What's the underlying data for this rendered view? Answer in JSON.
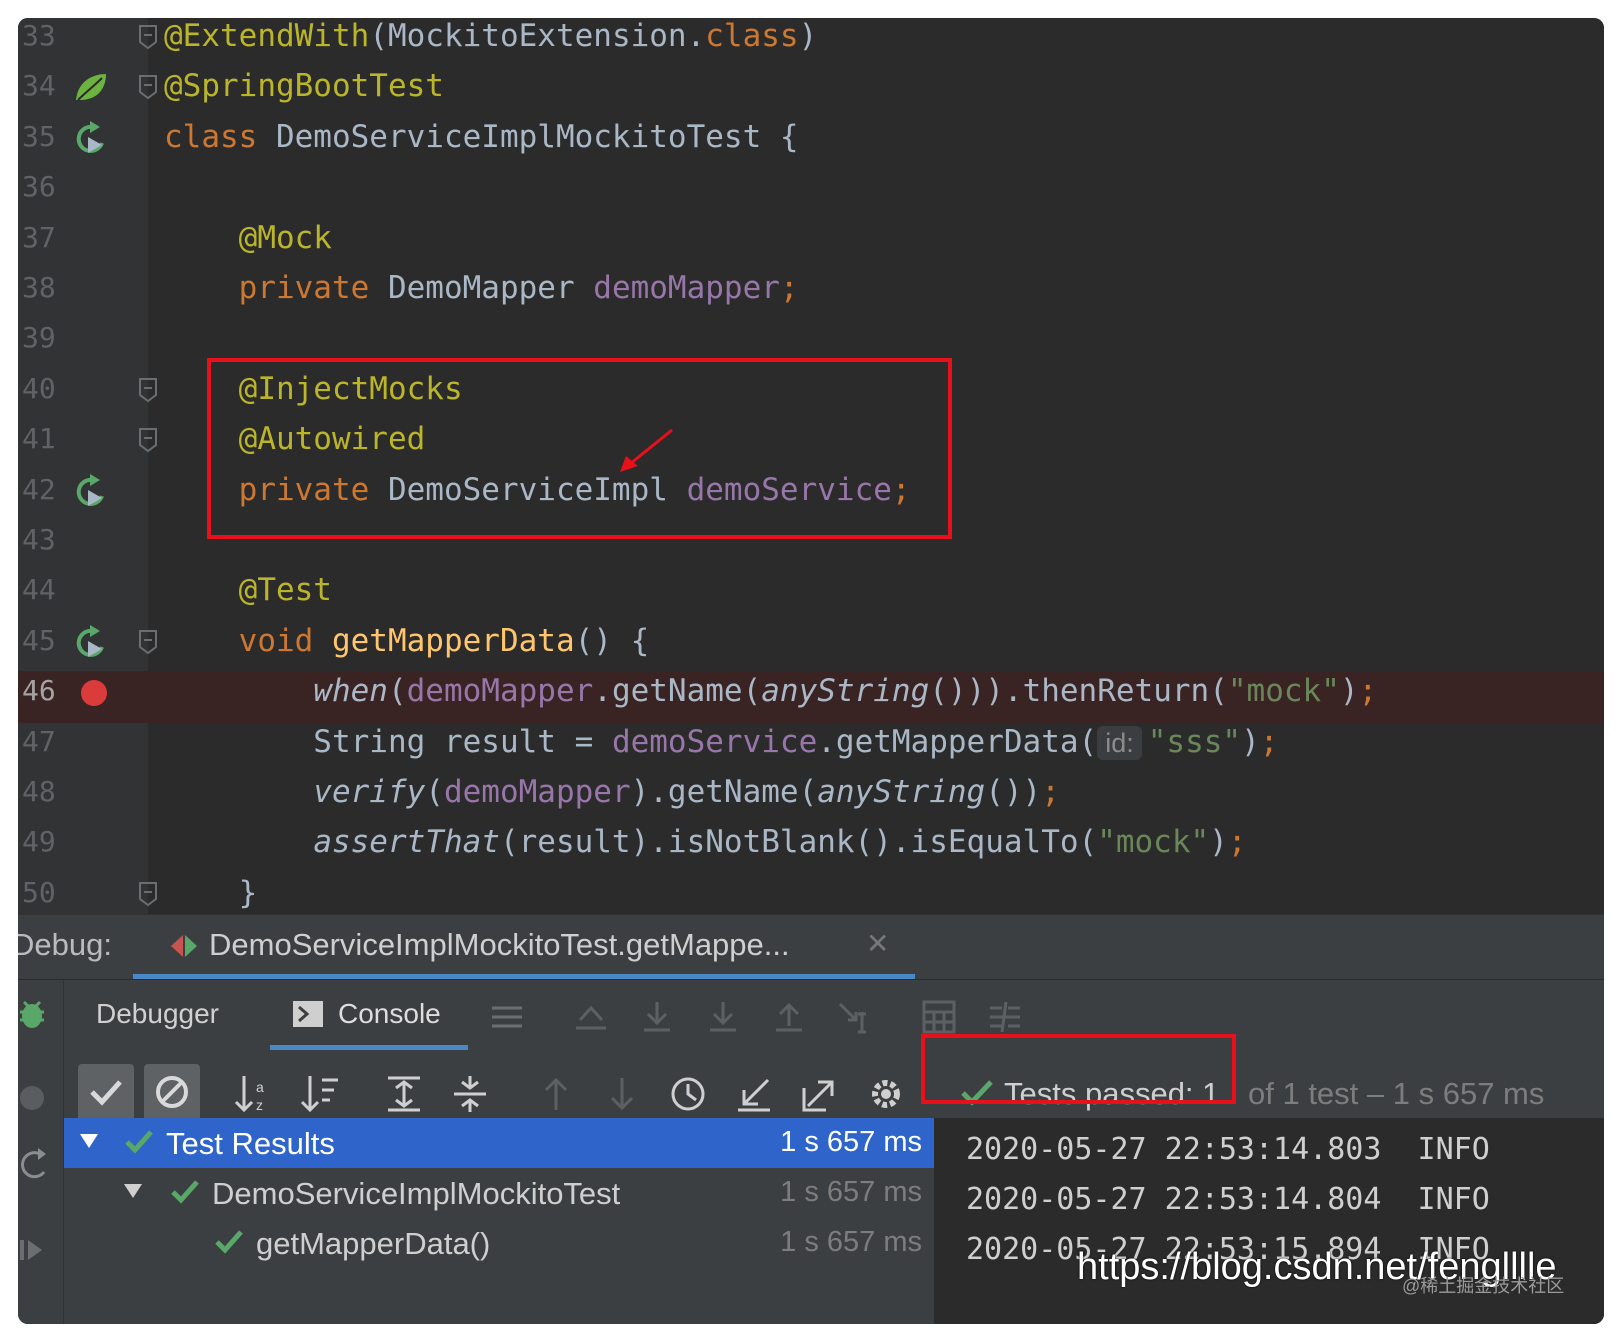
{
  "editor": {
    "lines": [
      {
        "num": "33",
        "tokens": [
          {
            "t": "@ExtendWith",
            "c": "ann"
          },
          {
            "t": "(MockitoExtension.",
            "c": ""
          },
          {
            "t": "class",
            "c": "kw"
          },
          {
            "t": ")",
            "c": ""
          }
        ]
      },
      {
        "num": "34",
        "tokens": [
          {
            "t": "@SpringBootTest",
            "c": "ann"
          }
        ]
      },
      {
        "num": "35",
        "tokens": [
          {
            "t": "class ",
            "c": "kw"
          },
          {
            "t": "DemoServiceImplMockitoTest {",
            "c": ""
          }
        ]
      },
      {
        "num": "36",
        "tokens": []
      },
      {
        "num": "37",
        "tokens": [
          {
            "t": "    ",
            "c": ""
          },
          {
            "t": "@Mock",
            "c": "ann"
          }
        ]
      },
      {
        "num": "38",
        "tokens": [
          {
            "t": "    ",
            "c": ""
          },
          {
            "t": "private ",
            "c": "kw"
          },
          {
            "t": "DemoMapper ",
            "c": ""
          },
          {
            "t": "demoMapper",
            "c": "fld"
          },
          {
            "t": ";",
            "c": "kw"
          }
        ]
      },
      {
        "num": "39",
        "tokens": []
      },
      {
        "num": "40",
        "tokens": [
          {
            "t": "    ",
            "c": ""
          },
          {
            "t": "@InjectMocks",
            "c": "ann"
          }
        ]
      },
      {
        "num": "41",
        "tokens": [
          {
            "t": "    ",
            "c": ""
          },
          {
            "t": "@Autowired",
            "c": "ann"
          }
        ]
      },
      {
        "num": "42",
        "tokens": [
          {
            "t": "    ",
            "c": ""
          },
          {
            "t": "private ",
            "c": "kw"
          },
          {
            "t": "DemoServiceImpl ",
            "c": ""
          },
          {
            "t": "demoService",
            "c": "fld"
          },
          {
            "t": ";",
            "c": "kw"
          }
        ]
      },
      {
        "num": "43",
        "tokens": []
      },
      {
        "num": "44",
        "tokens": [
          {
            "t": "    ",
            "c": ""
          },
          {
            "t": "@Test",
            "c": "ann"
          }
        ]
      },
      {
        "num": "45",
        "tokens": [
          {
            "t": "    ",
            "c": ""
          },
          {
            "t": "void ",
            "c": "kw"
          },
          {
            "t": "getMapperData",
            "c": "fn"
          },
          {
            "t": "() {",
            "c": ""
          }
        ]
      },
      {
        "num": "46",
        "tokens": [
          {
            "t": "        ",
            "c": ""
          },
          {
            "t": "when",
            "c": "it"
          },
          {
            "t": "(",
            "c": ""
          },
          {
            "t": "demoMapper",
            "c": "fld"
          },
          {
            "t": ".getName(",
            "c": ""
          },
          {
            "t": "anyString",
            "c": "it"
          },
          {
            "t": "())).thenReturn(",
            "c": ""
          },
          {
            "t": "\"mock\"",
            "c": "str"
          },
          {
            "t": ")",
            "c": ""
          },
          {
            "t": ";",
            "c": "kw"
          }
        ]
      },
      {
        "num": "47",
        "tokens": [
          {
            "t": "        String result = ",
            "c": ""
          },
          {
            "t": "demoService",
            "c": "fld"
          },
          {
            "t": ".getMapperData(",
            "c": ""
          },
          {
            "t": "id:",
            "c": "hint"
          },
          {
            "t": "\"sss\"",
            "c": "str"
          },
          {
            "t": ")",
            "c": ""
          },
          {
            "t": ";",
            "c": "kw"
          }
        ]
      },
      {
        "num": "48",
        "tokens": [
          {
            "t": "        ",
            "c": ""
          },
          {
            "t": "verify",
            "c": "it"
          },
          {
            "t": "(",
            "c": ""
          },
          {
            "t": "demoMapper",
            "c": "fld"
          },
          {
            "t": ").getName(",
            "c": ""
          },
          {
            "t": "anyString",
            "c": "it"
          },
          {
            "t": "())",
            "c": ""
          },
          {
            "t": ";",
            "c": "kw"
          }
        ]
      },
      {
        "num": "49",
        "tokens": [
          {
            "t": "        ",
            "c": ""
          },
          {
            "t": "assertThat",
            "c": "it"
          },
          {
            "t": "(result).isNotBlank().isEqualTo(",
            "c": ""
          },
          {
            "t": "\"mock\"",
            "c": "str"
          },
          {
            "t": ")",
            "c": ""
          },
          {
            "t": ";",
            "c": "kw"
          }
        ]
      },
      {
        "num": "50",
        "tokens": [
          {
            "t": "    }",
            "c": ""
          }
        ]
      }
    ],
    "breakpoint_line": "46",
    "colors": {
      "annotation": "#bbb529",
      "keyword": "#cc7832",
      "field": "#9876aa",
      "method": "#ffc66d",
      "string": "#6a8759",
      "highlight": "#e8101a"
    }
  },
  "debug": {
    "label": "Debug:",
    "session_tab": "DemoServiceImplMockitoTest.getMappe...",
    "tabs": {
      "debugger": "Debugger",
      "console": "Console"
    },
    "status_passed": "Tests passed: 1",
    "status_rest": "of 1 test – 1 s 657 ms",
    "tree": [
      {
        "name": "Test Results",
        "time": "1 s 657 ms"
      },
      {
        "name": "DemoServiceImplMockitoTest",
        "time": "1 s 657 ms"
      },
      {
        "name": "getMapperData()",
        "time": "1 s 657 ms"
      }
    ],
    "console_lines": [
      "2020-05-27 22:53:14.803  INFO",
      "2020-05-27 22:53:14.804  INFO",
      "2020-05-27 22:53:15.894  INFO"
    ]
  },
  "watermark": {
    "url": "https://blog.csdn.net/fenglllle",
    "secondary": "@稀土掘金技术社区"
  }
}
